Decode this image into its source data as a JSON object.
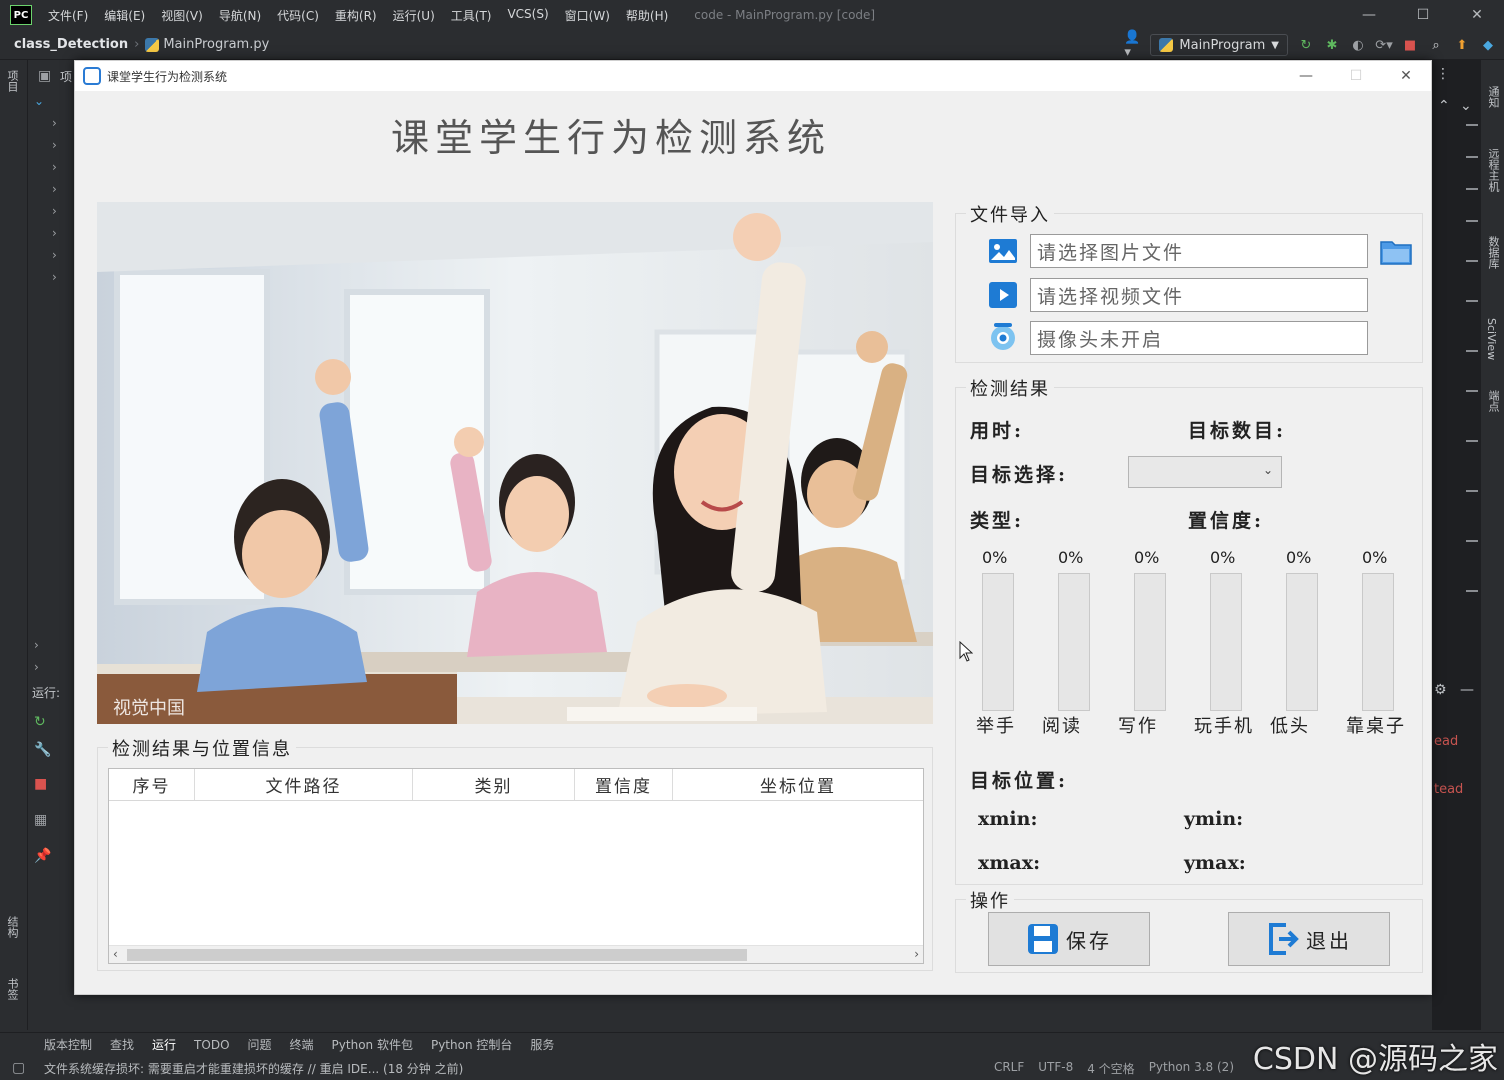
{
  "ide": {
    "logo": "PC",
    "menu": [
      "文件(F)",
      "编辑(E)",
      "视图(V)",
      "导航(N)",
      "代码(C)",
      "重构(R)",
      "运行(U)",
      "工具(T)",
      "VCS(S)",
      "窗口(W)",
      "帮助(H)"
    ],
    "title": "code - MainProgram.py [code]",
    "breadcrumb_project": "class_Detection",
    "breadcrumb_file": "MainProgram.py",
    "run_config": "MainProgram",
    "left_strip_project": "项目",
    "left_strip_structure": "结构",
    "left_strip_bookmarks": "书签",
    "project_panel_label": "项",
    "run_label": "运行:",
    "right_strip_labels": [
      "通知",
      "远程主机",
      "数据库",
      "SciView",
      "端点"
    ],
    "gutter_text_1": "ead",
    "gutter_text_2": "tead",
    "tool_tabs": [
      "版本控制",
      "查找",
      "运行",
      "TODO",
      "问题",
      "终端",
      "Python 软件包",
      "Python 控制台",
      "服务"
    ],
    "status_message": "文件系统缓存损坏: 需要重启才能重建损坏的缓存 // 重启 IDE... (18 分钟 之前)",
    "status_right": [
      "CRLF",
      "UTF-8",
      "4 个空格",
      "Python 3.8 (2)"
    ],
    "watermark": "CSDN @源码之家",
    "accent_colors": {
      "run": "#5fb85f",
      "stop": "#d9534f",
      "update": "#f0a030"
    }
  },
  "app": {
    "window_title": "课堂学生行为检测系统",
    "heading": "课堂学生行为检测系统",
    "photo_caption": "视觉中国",
    "file_import": {
      "title": "文件导入",
      "image_placeholder": "请选择图片文件",
      "video_placeholder": "请选择视频文件",
      "camera_status": "摄像头未开启"
    },
    "results": {
      "title": "检测结果",
      "time_label": "用时:",
      "count_label": "目标数目:",
      "select_label": "目标选择:",
      "type_label": "类型:",
      "confidence_label": "置信度:",
      "target_select_value": "",
      "bars": [
        {
          "name": "举手",
          "percent": "0%",
          "value": 0
        },
        {
          "name": "阅读",
          "percent": "0%",
          "value": 0
        },
        {
          "name": "写作",
          "percent": "0%",
          "value": 0
        },
        {
          "name": "玩手机",
          "percent": "0%",
          "value": 0
        },
        {
          "name": "低头",
          "percent": "0%",
          "value": 0
        },
        {
          "name": "靠桌子",
          "percent": "0%",
          "value": 0
        }
      ],
      "position_label": "目标位置:",
      "xmin_label": "xmin:",
      "ymin_label": "ymin:",
      "xmax_label": "xmax:",
      "ymax_label": "ymax:"
    },
    "table": {
      "title": "检测结果与位置信息",
      "columns": [
        "序号",
        "文件路径",
        "类别",
        "置信度",
        "坐标位置"
      ],
      "rows": []
    },
    "operations": {
      "title": "操作",
      "save_label": "保存",
      "exit_label": "退出"
    },
    "colors": {
      "accent": "#1e7bd4",
      "bar_fill": "#2a9d3e"
    }
  }
}
